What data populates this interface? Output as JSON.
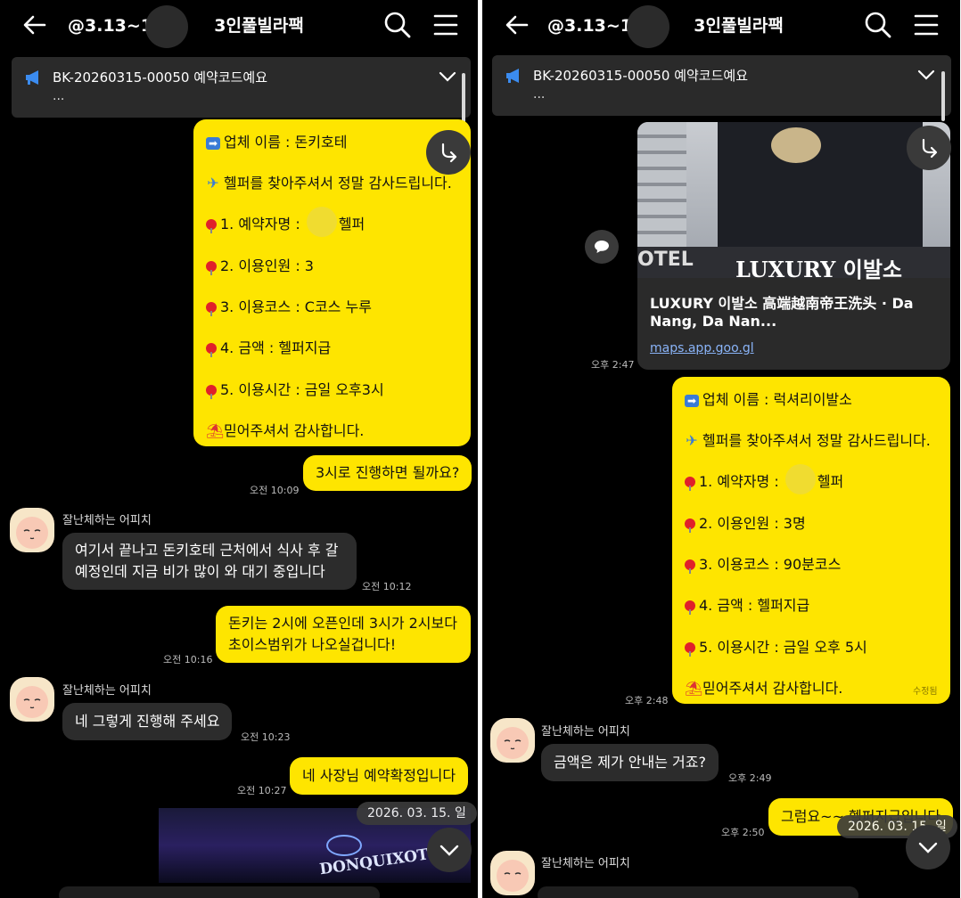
{
  "left": {
    "header": {
      "title_prefix": "@3.13~15",
      "title_suffix": "3인풀빌라팩"
    },
    "notice": {
      "text": "BK-20260315-00050 예약코드예요",
      "dots": "..."
    },
    "booking": {
      "line1": "업체 이름 : 돈키호테",
      "line2": "헬퍼를 찾아주셔서 정말 감사드립니다.",
      "line3_a": "1. 예약자명 :",
      "line3_b": "헬퍼",
      "line4": "2. 이용인원 :  3",
      "line5": "3. 이용코스 :  C코스 누루",
      "line6": "4. 금액 : 헬퍼지급",
      "line7": "5. 이용시간 : 금일 오후3시",
      "line8": "믿어주셔서 감사합니다."
    },
    "messages": {
      "m1": "3시로 진행하면 될까요?",
      "t1": "오전 10:09",
      "sender": "잘난체하는 어피치",
      "m2_1": "여기서 끝나고 돈키호테 근처에서 식사 후  갈",
      "m2_2": "예정인데 지금 비가 많이 와 대기 중입니다",
      "t2": "오전 10:12",
      "m3_1": "돈키는 2시에 오픈인데 3시가 2시보다",
      "m3_2": "초이스범위가 나오실겁니다!",
      "t3": "오전 10:16",
      "m4": "네 그렇게 진행해 주세요",
      "t4": "오전 10:23",
      "m5": "네 사장님 예약확정입니다",
      "t5": "오전 10:27"
    },
    "photo_sign": "DONQUIXOTE",
    "date_pill": "2026. 03. 15. 일"
  },
  "right": {
    "header": {
      "title_prefix": "@3.13~15",
      "title_suffix": "3인풀빌라팩"
    },
    "notice": {
      "text": "BK-20260315-00050 예약코드예요",
      "dots": "..."
    },
    "link_card": {
      "title_1": "LUXURY 이발소 高端越南帝王洗头 · Da",
      "title_2": "Nang, Da Nan...",
      "url": "maps.app.goo.gl",
      "sign_text": "LUXURY 이발소",
      "sign_small": "OTEL",
      "time": "오후 2:47"
    },
    "booking": {
      "line1": "업체 이름 : 럭셔리이발소",
      "line2": "헬퍼를 찾아주셔서 정말 감사드립니다.",
      "line3_a": "1. 예약자명 :",
      "line3_b": "헬퍼",
      "line4": "2. 이용인원 :  3명",
      "line5": "3. 이용코스 :  90분코스",
      "line6": "4. 금액 : 헬퍼지급",
      "line7": "5. 이용시간 : 금일 오후 5시",
      "line8": "믿어주셔서 감사합니다.",
      "edited": "수정됨",
      "time": "오후 2:48"
    },
    "messages": {
      "sender": "잘난체하는 어피치",
      "m1": "금액은 제가 안내는 거죠?",
      "t1": "오후 2:49",
      "m2_a": "그럼요~~",
      "m2_b": "헬퍼지급입니다",
      "t2": "오후 2:50",
      "sender2": "잘난체하는 어피치"
    },
    "date_pill": "2026. 03. 15. 일"
  },
  "colors": {
    "bubble_mine": "#fee500",
    "bubble_other": "#2c2c2c",
    "background": "#000000",
    "link": "#8ab4f8"
  }
}
